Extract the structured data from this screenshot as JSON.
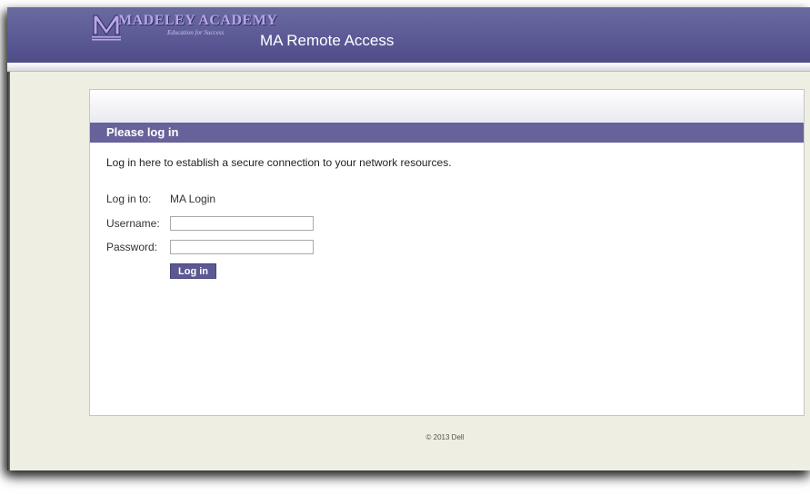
{
  "header": {
    "logo_text": "MADELEY ACADEMY",
    "logo_tagline": "Education for Success",
    "app_title": "MA Remote Access"
  },
  "login_panel": {
    "heading": "Please log in",
    "intro": "Log in here to establish a secure connection to your network resources.",
    "login_to_label": "Log in to:",
    "login_to_value": "MA Login",
    "username_label": "Username:",
    "username_value": "",
    "password_label": "Password:",
    "password_value": "",
    "submit_label": "Log in"
  },
  "footer": {
    "copyright": "© 2013 Dell"
  },
  "colors": {
    "header_purple": "#5c5a96",
    "bar_purple": "#676299",
    "page_background": "#efeee2"
  }
}
